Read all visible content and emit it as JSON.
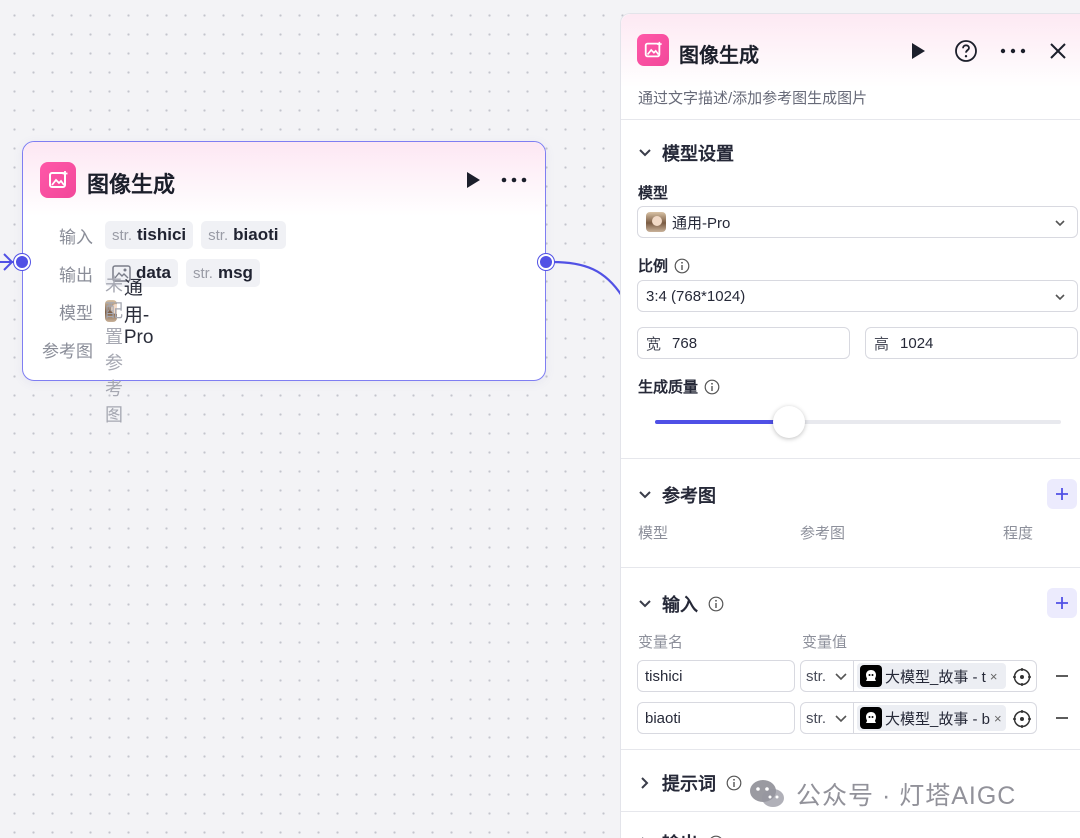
{
  "node": {
    "title": "图像生成",
    "rows": {
      "input_label": "输入",
      "output_label": "输出",
      "model_label": "模型",
      "ref_label": "参考图"
    },
    "inputs": [
      {
        "type": "str.",
        "name": "tishici"
      },
      {
        "type": "str.",
        "name": "biaoti"
      }
    ],
    "outputs": [
      {
        "type": "image-icon",
        "name": "data"
      },
      {
        "type": "str.",
        "name": "msg"
      }
    ],
    "model": "通用-Pro",
    "ref_value": "未配置参考图"
  },
  "panel": {
    "title": "图像生成",
    "description": "通过文字描述/添加参考图生成图片",
    "model_section": {
      "heading": "模型设置",
      "model_label": "模型",
      "model_value": "通用-Pro",
      "ratio_label": "比例",
      "ratio_value": "3:4 (768*1024)",
      "width_prefix": "宽",
      "width_value": "768",
      "height_prefix": "高",
      "height_value": "1024",
      "quality_label": "生成质量",
      "quality_level": 0.33
    },
    "ref_section": {
      "heading": "参考图",
      "columns": [
        "模型",
        "参考图",
        "程度"
      ]
    },
    "input_section": {
      "heading": "输入",
      "col_name": "变量名",
      "col_value": "变量值",
      "rows": [
        {
          "name": "tishici",
          "type": "str.",
          "ref": "大模型_故事 - t"
        },
        {
          "name": "biaoti",
          "type": "str.",
          "ref": "大模型_故事 - b"
        }
      ]
    },
    "prompt_section": {
      "heading": "提示词"
    },
    "output_section": {
      "heading": "输出"
    }
  },
  "watermark": "公众号 · 灯塔AIGC",
  "colors": {
    "accent": "#5151e5",
    "brand_pink": "#f2489a"
  }
}
